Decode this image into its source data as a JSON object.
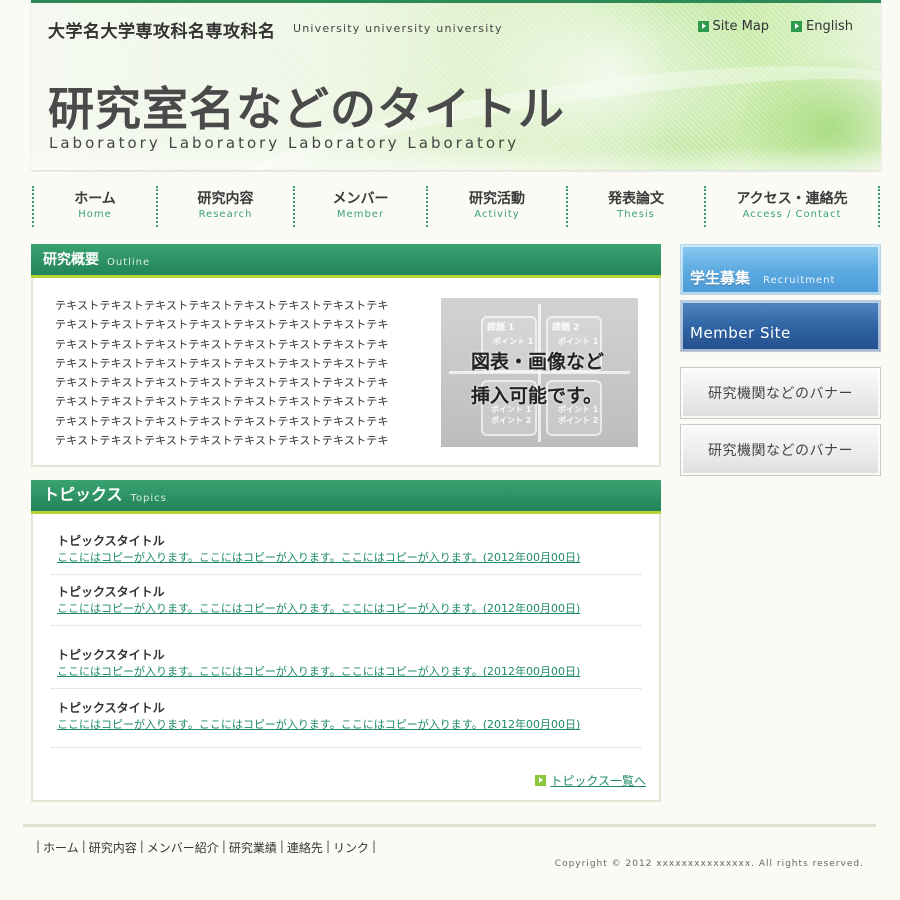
{
  "header": {
    "university": "大学名大学専攻科名専攻科名",
    "university_en": "University university university",
    "lab_title": "研究室名などのタイトル",
    "lab_title_en": "Laboratory Laboratory Laboratory Laboratory",
    "links": [
      {
        "label": "Site Map",
        "icon": "arrow-icon"
      },
      {
        "label": "English",
        "icon": "arrow-icon"
      }
    ]
  },
  "nav": [
    {
      "jp": "ホーム",
      "en": "Home"
    },
    {
      "jp": "研究内容",
      "en": "Research"
    },
    {
      "jp": "メンバー",
      "en": "Member"
    },
    {
      "jp": "研究活動",
      "en": "Activity"
    },
    {
      "jp": "発表論文",
      "en": "Thesis"
    },
    {
      "jp": "アクセス・連絡先",
      "en": "Access / Contact"
    }
  ],
  "outline": {
    "title": "研究概要",
    "title_en": "Outline",
    "lines": [
      "テキストテキストテキストテキストテキストテキストテキストテキ",
      "テキストテキストテキストテキストテキストテキストテキストテキ",
      "テキストテキストテキストテキストテキストテキストテキストテキ",
      "テキストテキストテキストテキストテキストテキストテキストテキ",
      "テキストテキストテキストテキストテキストテキストテキストテキ",
      "テキストテキストテキストテキストテキストテキストテキストテキ",
      "テキストテキストテキストテキストテキストテキストテキストテキ",
      "テキストテキストテキストテキストテキストテキストテキストテキ"
    ],
    "figure": {
      "caption_line1": "図表・画像など",
      "caption_line2": "挿入可能です。",
      "box_labels": [
        "課題 1",
        "課題 2",
        "ポイント 1",
        "ポイント 1",
        "ポイント 1",
        "ポイント 1",
        "ポイント 2",
        "ポイント 2"
      ]
    }
  },
  "topics": {
    "title": "トピックス",
    "title_en": "Topics",
    "items": [
      {
        "title": "トピックスタイトル",
        "link": "ここにはコピーが入ります。ここにはコピーが入ります。ここにはコピーが入ります。(2012年00月00日)"
      },
      {
        "title": "トピックスタイトル",
        "link": "ここにはコピーが入ります。ここにはコピーが入ります。ここにはコピーが入ります。(2012年00月00日)"
      },
      {
        "title": "トピックスタイトル",
        "link": "ここにはコピーが入ります。ここにはコピーが入ります。ここにはコピーが入ります。(2012年00月00日)"
      },
      {
        "title": "トピックスタイトル",
        "link": "ここにはコピーが入ります。ここにはコピーが入ります。ここにはコピーが入ります。(2012年00月00日)"
      }
    ],
    "more": "トピックス一覧へ"
  },
  "sidebar": {
    "recruit_jp": "学生募集",
    "recruit_en": "Recruitment",
    "member_site": "Member Site",
    "banner1": "研究機関などのバナー",
    "banner2": "研究機関などのバナー"
  },
  "footer": {
    "links": [
      "ホーム",
      "研究内容",
      "メンバー紹介",
      "研究業績",
      "連絡先",
      "リンク"
    ],
    "copyright": "Copyright © 2012 xxxxxxxxxxxxxxx. All rights reserved."
  },
  "colors": {
    "accent_green": "#2e8a55",
    "head_green": "#23845a",
    "lime": "#b4d233",
    "link_green": "#1f8a6a"
  }
}
